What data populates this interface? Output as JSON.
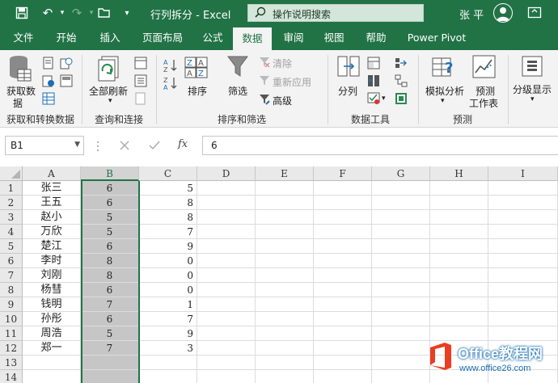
{
  "titlebar": {
    "title": "行列拆分  -  Excel",
    "search": "操作说明搜索",
    "user": "张 平"
  },
  "tabs": [
    "文件",
    "开始",
    "插入",
    "页面布局",
    "公式",
    "数据",
    "审阅",
    "视图",
    "帮助",
    "Power Pivot"
  ],
  "active_tab": "数据",
  "ribbon": {
    "get_data": "获取数",
    "get_data2": "据",
    "refresh_all": "全部刷新",
    "sort": "排序",
    "filter": "筛选",
    "clear": "清除",
    "reapply": "重新应用",
    "advanced": "高级",
    "split": "分列",
    "whatif": "模拟分析",
    "forecast_sheet": "预测",
    "forecast_sheet2": "工作表",
    "outline": "分级显示",
    "groups": {
      "get_transform": "获取和转换数据",
      "queries": "查询和连接",
      "sort_filter": "排序和筛选",
      "data_tools": "数据工具",
      "forecast": "预测"
    }
  },
  "formula_bar": {
    "name_box": "B1",
    "fx": "fx",
    "value": "6"
  },
  "columns": [
    "A",
    "B",
    "C",
    "D",
    "E",
    "F",
    "G",
    "H",
    "I"
  ],
  "selected_column": "B",
  "rows": [
    {
      "n": "1",
      "a": "张三",
      "b": "6",
      "c": "5"
    },
    {
      "n": "2",
      "a": "王五",
      "b": "6",
      "c": "8"
    },
    {
      "n": "3",
      "a": "赵小",
      "b": "5",
      "c": "8"
    },
    {
      "n": "4",
      "a": "万欣",
      "b": "5",
      "c": "7"
    },
    {
      "n": "5",
      "a": "楚江",
      "b": "6",
      "c": "9"
    },
    {
      "n": "6",
      "a": "李时",
      "b": "8",
      "c": "0"
    },
    {
      "n": "7",
      "a": "刘刚",
      "b": "8",
      "c": "0"
    },
    {
      "n": "8",
      "a": "杨彗",
      "b": "6",
      "c": "0"
    },
    {
      "n": "9",
      "a": "钱明",
      "b": "7",
      "c": "1"
    },
    {
      "n": "10",
      "a": "孙彤",
      "b": "6",
      "c": "7"
    },
    {
      "n": "11",
      "a": "周浩",
      "b": "5",
      "c": "9"
    },
    {
      "n": "12",
      "a": "郑一",
      "b": "7",
      "c": "3"
    },
    {
      "n": "13",
      "a": "",
      "b": "",
      "c": ""
    },
    {
      "n": "14",
      "a": "",
      "b": "",
      "c": ""
    }
  ],
  "watermark": {
    "title": "Office教程网",
    "url": "www.office26.com"
  },
  "colors": {
    "excel_green": "#217346",
    "selection_gray": "#c6c6c6"
  }
}
